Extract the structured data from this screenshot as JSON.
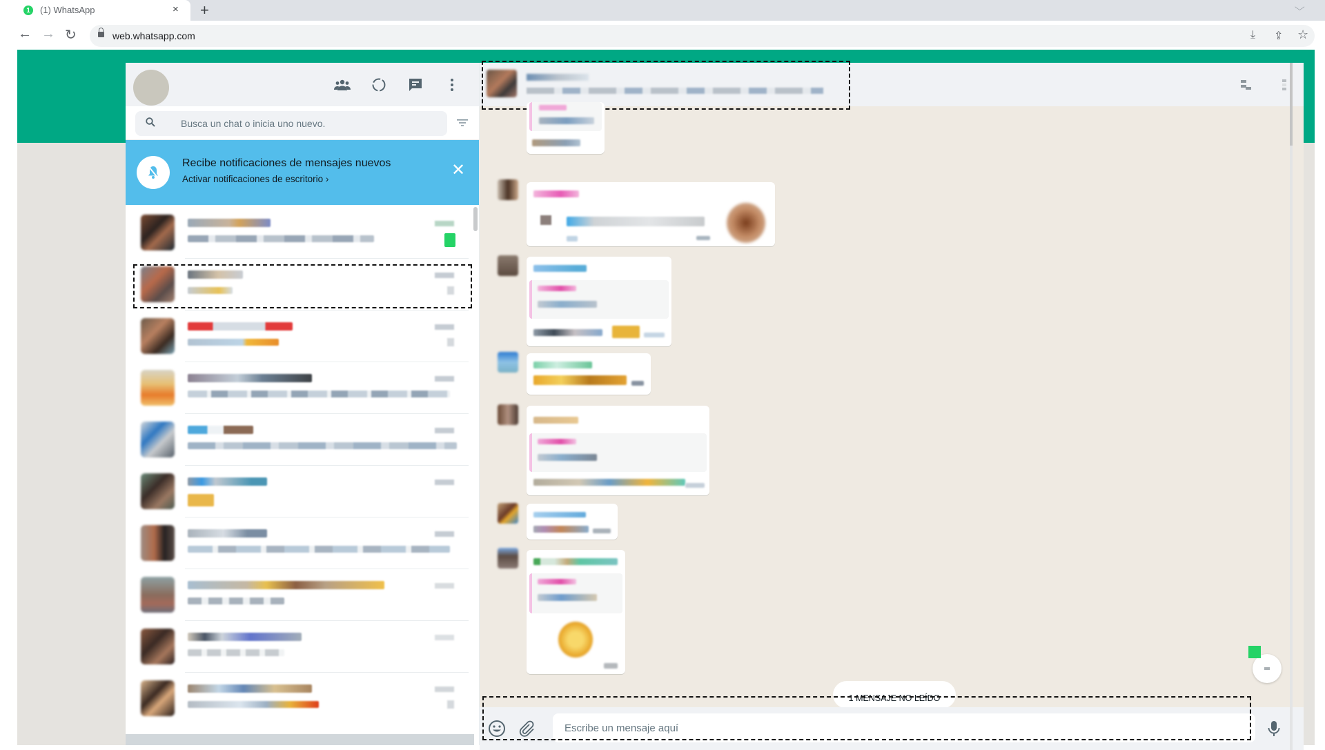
{
  "browser": {
    "tab_title": "(1) WhatsApp",
    "tab_badge": "1",
    "tab_close_icon": "×",
    "new_tab_icon": "+",
    "tab_search_icon": "⌵",
    "url": "web.whatsapp.com",
    "back_icon": "←",
    "forward_icon": "→",
    "reload_icon": "↻",
    "install_icon": "⤓",
    "share_icon": "⇪",
    "bookmark_icon": "☆"
  },
  "sidebar": {
    "header_icons": [
      "communities-icon",
      "status-icon",
      "new-chat-icon",
      "menu-icon"
    ],
    "search": {
      "placeholder": "Busca un chat o inicia uno nuevo.",
      "value": ""
    },
    "notification": {
      "title": "Recibe notificaciones de mensajes nuevos",
      "link": "Activar notificaciones de escritorio ›",
      "close_icon": "✕"
    },
    "chats": [
      {
        "name": "[blurred]",
        "preview": "[blurred]",
        "time": "[blurred]",
        "unread": true
      },
      {
        "name": "[blurred]",
        "preview": "[blurred]",
        "time": "[blurred]",
        "unread": false,
        "highlighted": true
      },
      {
        "name": "[blurred]",
        "preview": "[blurred]",
        "time": "[blurred]",
        "unread": false
      },
      {
        "name": "[blurred]",
        "preview": "[blurred]",
        "time": "[blurred]",
        "unread": false
      },
      {
        "name": "[blurred]",
        "preview": "[blurred]",
        "time": "[blurred]",
        "unread": false
      },
      {
        "name": "[blurred]",
        "preview": "[blurred]",
        "time": "[blurred]",
        "unread": false
      },
      {
        "name": "[blurred]",
        "preview": "[blurred]",
        "time": "[blurred]",
        "unread": false
      },
      {
        "name": "[blurred]",
        "preview": "[blurred]",
        "time": "[blurred]",
        "unread": false
      },
      {
        "name": "[blurred]",
        "preview": "[blurred]",
        "time": "[blurred]",
        "unread": false
      },
      {
        "name": "[blurred]",
        "preview": "[blurred]",
        "time": "[blurred]",
        "unread": false
      }
    ]
  },
  "conversation": {
    "contact_name": "[blurred]",
    "contact_subtitle": "[blurred]",
    "header_icons": [
      "search-icon",
      "menu-icon"
    ],
    "unread_label": "1 MENSAJE NO LEÍDO",
    "composer": {
      "placeholder": "Escribe un mensaje aquí",
      "value": ""
    },
    "messages": [
      {
        "type": "reply",
        "sender": "[blurred]",
        "text": "[blurred]"
      },
      {
        "type": "voice",
        "sender": "[blurred]",
        "text": "[blurred]"
      },
      {
        "type": "reply",
        "sender": "[blurred]",
        "text": "[blurred]"
      },
      {
        "type": "text",
        "sender": "[blurred]",
        "text": "[blurred]"
      },
      {
        "type": "reply",
        "sender": "[blurred]",
        "text": "[blurred]"
      },
      {
        "type": "text",
        "sender": "[blurred]",
        "text": "[blurred]"
      },
      {
        "type": "sticker-reply",
        "sender": "[blurred]",
        "text": "[blurred]"
      }
    ]
  },
  "colors": {
    "brand_green": "#00a884",
    "notification_blue": "#53bdeb",
    "unread_green": "#25d366",
    "chat_bg": "#efeae2",
    "panel_header": "#f0f2f5"
  }
}
